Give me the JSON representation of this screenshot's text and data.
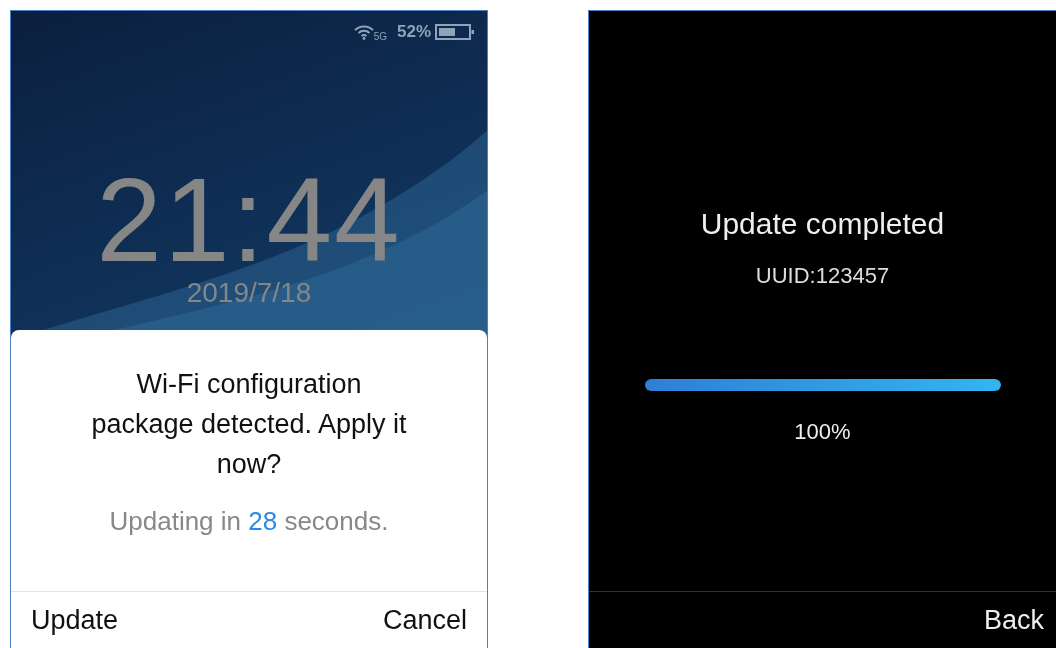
{
  "lock_screen": {
    "status_bar": {
      "network_badge": "5G",
      "battery_percent": "52%"
    },
    "clock": {
      "time": "21:44",
      "date": "2019/7/18"
    },
    "dialog": {
      "message": "Wi-Fi configuration package detected. Apply it now?",
      "countdown": {
        "before": "Updating in",
        "seconds": "28",
        "after": "seconds."
      },
      "buttons": [
        {
          "label": "Update",
          "kind": "left"
        },
        {
          "label": "Cancel",
          "kind": "right"
        }
      ]
    }
  },
  "update_screen": {
    "title": "Update completed",
    "uuid": "UUID:123457",
    "progress": {
      "level": 1.0,
      "reading": "100%"
    },
    "buttons": [
      {
        "label": "Back",
        "kind": "right"
      }
    ]
  }
}
